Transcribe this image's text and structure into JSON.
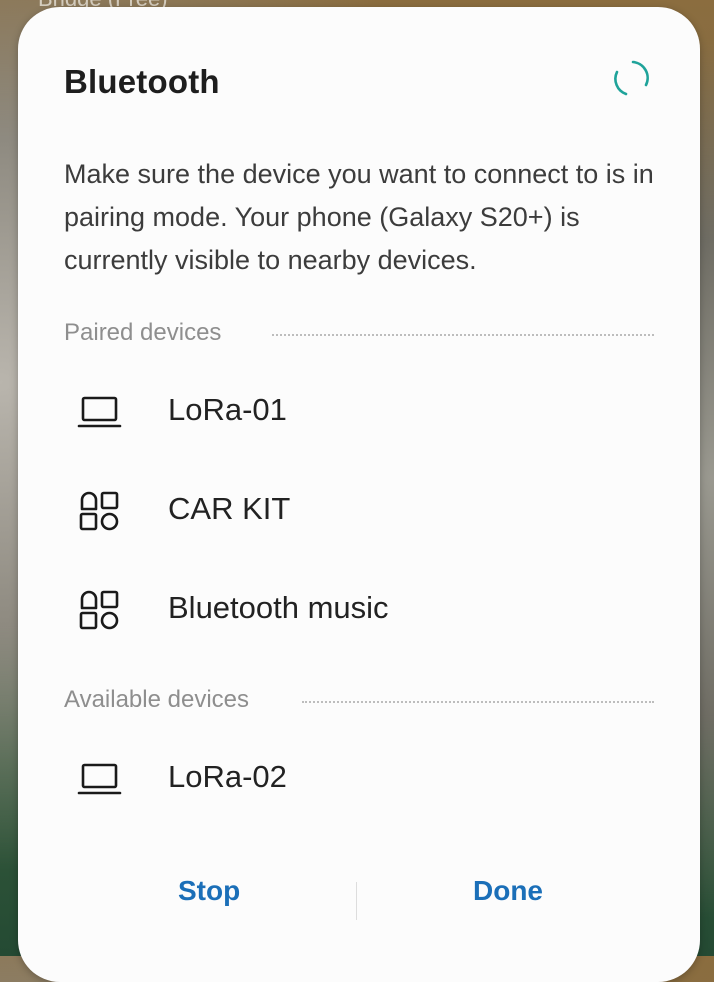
{
  "background_peek_text": "Bridge (Free)",
  "dialog": {
    "title": "Bluetooth",
    "description": "Make sure the device you want to connect to is in pairing mode. Your phone (Galaxy S20+) is currently visible to nearby devices.",
    "spinner_icon": "loading-spinner-icon",
    "spinner_color": "#1fa39a"
  },
  "paired": {
    "label": "Paired devices",
    "devices": [
      {
        "name": "LoRa-01",
        "icon": "laptop-icon"
      },
      {
        "name": "CAR KIT",
        "icon": "generic-device-icon"
      },
      {
        "name": "Bluetooth music",
        "icon": "generic-device-icon"
      }
    ]
  },
  "available": {
    "label": "Available devices",
    "devices": [
      {
        "name": "LoRa-02",
        "icon": "laptop-icon"
      }
    ]
  },
  "buttons": {
    "stop": "Stop",
    "done": "Done"
  },
  "colors": {
    "accent": "#1b6fb8",
    "section_label": "#8e8e8e"
  }
}
